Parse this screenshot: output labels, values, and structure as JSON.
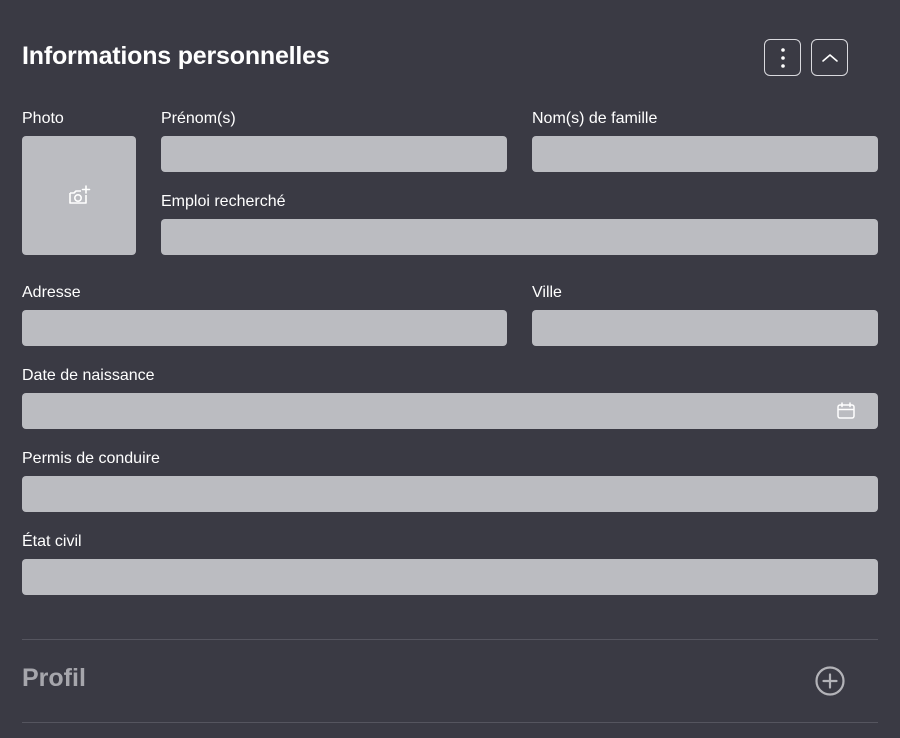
{
  "section": {
    "title": "Informations personnelles",
    "more_icon": "vertical-dots-icon",
    "collapse_icon": "chevron-up-icon"
  },
  "fields": {
    "photo": {
      "label": "Photo",
      "icon": "camera-add-icon"
    },
    "first_name": {
      "label": "Prénom(s)",
      "value": ""
    },
    "last_name": {
      "label": "Nom(s) de famille",
      "value": ""
    },
    "job": {
      "label": "Emploi recherché",
      "value": ""
    },
    "address": {
      "label": "Adresse",
      "value": ""
    },
    "city": {
      "label": "Ville",
      "value": ""
    },
    "birth_date": {
      "label": "Date de naissance",
      "value": "",
      "icon": "calendar-icon"
    },
    "license": {
      "label": "Permis de conduire",
      "value": ""
    },
    "marital_status": {
      "label": "État civil",
      "value": ""
    }
  },
  "profile": {
    "title": "Profil",
    "add_icon": "plus-circle-icon"
  },
  "colors": {
    "background": "#3a3a44",
    "field": "#bbbcc1",
    "muted_title": "#a6a6ac"
  }
}
